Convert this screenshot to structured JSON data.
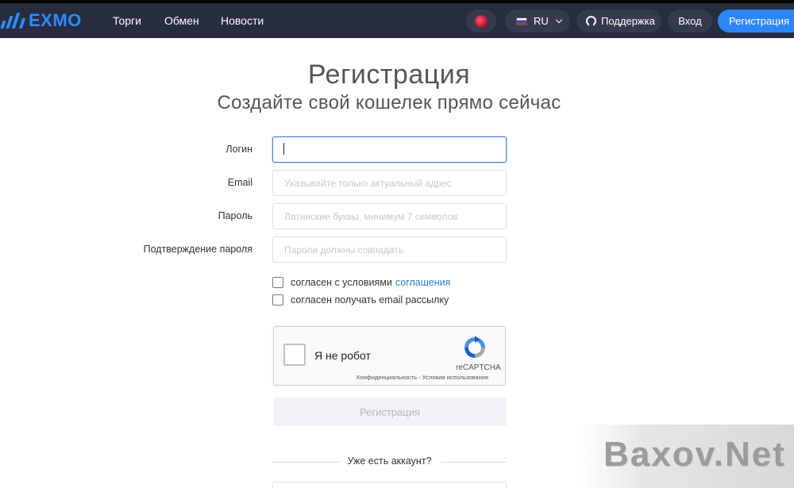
{
  "header": {
    "logo_text": "EXMO",
    "nav": {
      "trade": "Торги",
      "exchange": "Обмен",
      "news": "Новости"
    },
    "language": "RU",
    "support": "Поддержка",
    "login": "Вход",
    "register": "Регистрация"
  },
  "form": {
    "title": "Регистрация",
    "subtitle": "Создайте свой кошелек прямо сейчас",
    "login_label": "Логин",
    "login_value": "",
    "email_label": "Email",
    "email_placeholder": "Указывайте только актуальный адрес",
    "password_label": "Пароль",
    "password_placeholder": "Латинские буквы, минимум 7 символов",
    "confirm_label": "Подтверждение пароля",
    "confirm_placeholder": "Пароли должны совпадать",
    "agree_text": "согласен с условиями",
    "agree_link": "соглашения",
    "newsletter_text": "согласен получать email рассылку",
    "submit_label": "Регистрация",
    "have_account": "Уже есть аккаунт?"
  },
  "captcha": {
    "label": "Я не робот",
    "brand": "reCAPTCHA",
    "footer": "Конфиденциальность - Условия использования"
  },
  "watermark": "Baxov.Net",
  "colors": {
    "header_bg": "#282c3f",
    "accent": "#2d86f7",
    "logo": "#2d8cff",
    "link": "#2d7bd6"
  }
}
